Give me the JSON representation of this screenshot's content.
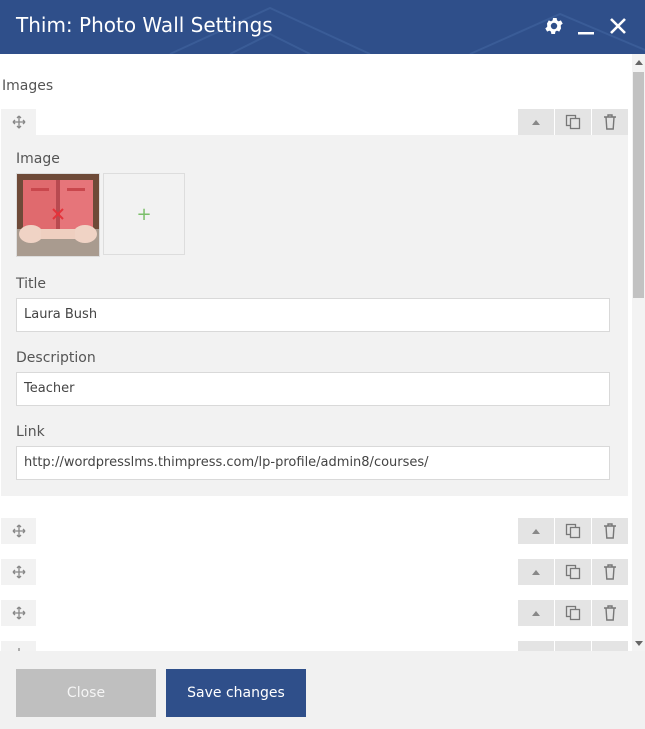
{
  "header": {
    "title": "Thim: Photo Wall Settings"
  },
  "icons": {
    "settings": "gear-icon",
    "minimize": "minimize-icon",
    "close": "close-icon",
    "move": "move-icon",
    "collapse": "caret-up-icon",
    "duplicate": "copy-icon",
    "delete": "trash-icon",
    "add": "plus-icon",
    "remove_image": "x-icon"
  },
  "form": {
    "section_label": "Images",
    "item": {
      "image_label": "Image",
      "add_symbol": "+",
      "title_label": "Title",
      "title_value": "Laura Bush",
      "description_label": "Description",
      "description_value": "Teacher",
      "link_label": "Link",
      "link_value": "http://wordpresslms.thimpress.com/lp-profile/admin8/courses/"
    }
  },
  "footer": {
    "close_label": "Close",
    "save_label": "Save changes"
  },
  "colors": {
    "header_bg": "#2f4f8a",
    "save_button": "#2f4f8a",
    "close_button": "#bfbfbf",
    "panel_bg": "#f2f2f2"
  }
}
